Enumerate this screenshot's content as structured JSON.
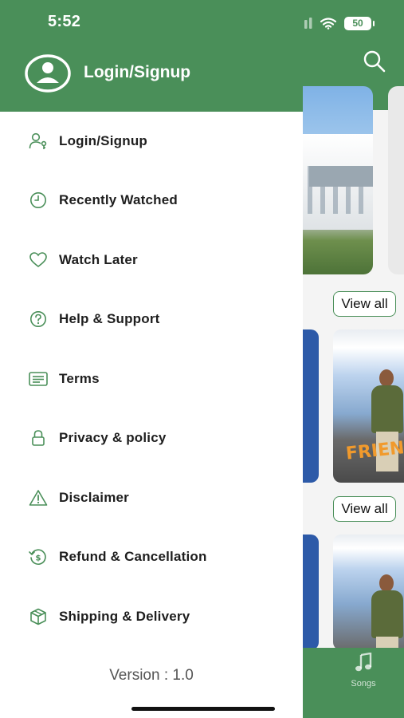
{
  "status_bar": {
    "time": "5:52",
    "battery": "50"
  },
  "drawer": {
    "header_title": "Login/Signup",
    "items": [
      {
        "label": "Login/Signup",
        "icon": "user-key-icon"
      },
      {
        "label": "Recently Watched",
        "icon": "clock-icon"
      },
      {
        "label": "Watch Later",
        "icon": "heart-icon"
      },
      {
        "label": "Help & Support",
        "icon": "help-circle-icon"
      },
      {
        "label": "Terms",
        "icon": "document-icon"
      },
      {
        "label": "Privacy & policy",
        "icon": "lock-icon"
      },
      {
        "label": "Disclaimer",
        "icon": "warning-icon"
      },
      {
        "label": "Refund & Cancellation",
        "icon": "refund-icon"
      },
      {
        "label": "Shipping & Delivery",
        "icon": "box-icon"
      }
    ],
    "version": "Version : 1.0"
  },
  "background": {
    "view_all_1": "View all",
    "view_all_2": "View all",
    "tab_songs": "Songs"
  },
  "colors": {
    "brand": "#4a8f59",
    "text": "#1e1e1e"
  }
}
